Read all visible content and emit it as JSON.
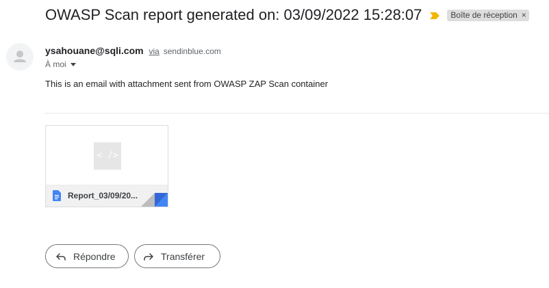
{
  "email": {
    "subject": "OWASP Scan report generated on: 03/09/2022 15:28:07",
    "label": "Boîte de réception",
    "label_close": "×",
    "sender_email": "ysahouane@sqli.com",
    "via_word": "via",
    "via_domain": "sendinblue.com",
    "recipient": "À moi",
    "body": "This is an email with attachment sent from OWASP ZAP Scan container"
  },
  "attachment": {
    "thumb_glyph": "< />",
    "filename": "Report_03/09/20..."
  },
  "actions": {
    "reply_label": "Répondre",
    "forward_label": "Transférer"
  },
  "colors": {
    "importance_marker": "#f4b400",
    "doc_icon": "#4285f4",
    "corner_fold_blue": "#4285f4",
    "corner_fold_gray": "#bdbdbd"
  }
}
